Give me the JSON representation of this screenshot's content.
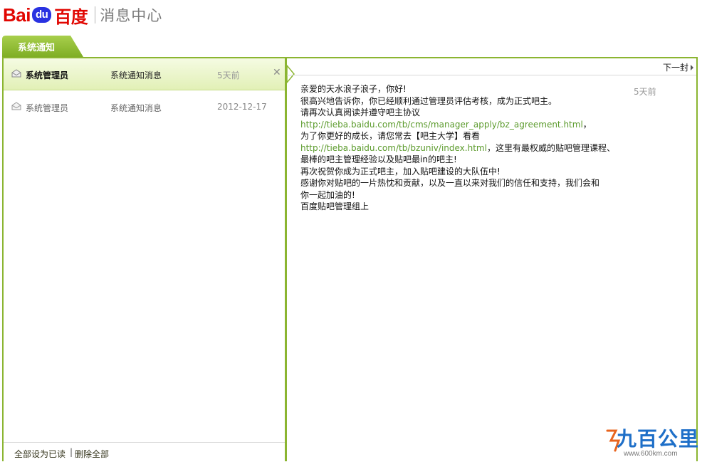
{
  "header": {
    "logo_bai": "Bai",
    "logo_du": "du",
    "logo_cn": "百度",
    "title": "消息中心"
  },
  "tab": {
    "label": "系统通知",
    "color": "#8bb531"
  },
  "list": {
    "items": [
      {
        "sender": "系统管理员",
        "subject": "系统通知消息",
        "date": "5天前",
        "active": true
      },
      {
        "sender": "系统管理员",
        "subject": "系统通知消息",
        "date": "2012-12-17",
        "active": false
      }
    ],
    "footer": {
      "mark_all_read": "全部设为已读",
      "separator": "|",
      "delete_all": "删除全部"
    }
  },
  "detail": {
    "next_label": "下一封",
    "time": "5天前",
    "lines": {
      "l1": "亲爱的天水浪子浪子，你好!",
      "l2": "很高兴地告诉你，你已经顺利通过管理员评估考核，成为正式吧主。",
      "l3": "请再次认真阅读并遵守吧主协议",
      "l4_link": "http://tieba.baidu.com/tb/cms/manager_apply/bz_agreement.html",
      "l4_tail": "，",
      "l5": "为了你更好的成长，请您常去【吧主大学】看看",
      "l6_link": "http://tieba.baidu.com/tb/bzuniv/index.html",
      "l6_tail": "，这里有最权威的贴吧管理课程、",
      "l7": "最棒的吧主管理经验以及贴吧最in的吧主!",
      "l8": "再次祝贺你成为正式吧主，加入贴吧建设的大队伍中!",
      "l9": "感谢你对贴吧的一片热忱和贡献，以及一直以来对我们的信任和支持，我们会和",
      "l10": "你一起加油的!",
      "l11": "百度贴吧管理组上"
    }
  },
  "watermark": {
    "text": "九百公里",
    "url": "www.600km.com"
  },
  "colors": {
    "accent": "#8bb531",
    "link": "#5c9b2d",
    "baidu_red": "#e10601",
    "baidu_blue": "#2932e1"
  }
}
